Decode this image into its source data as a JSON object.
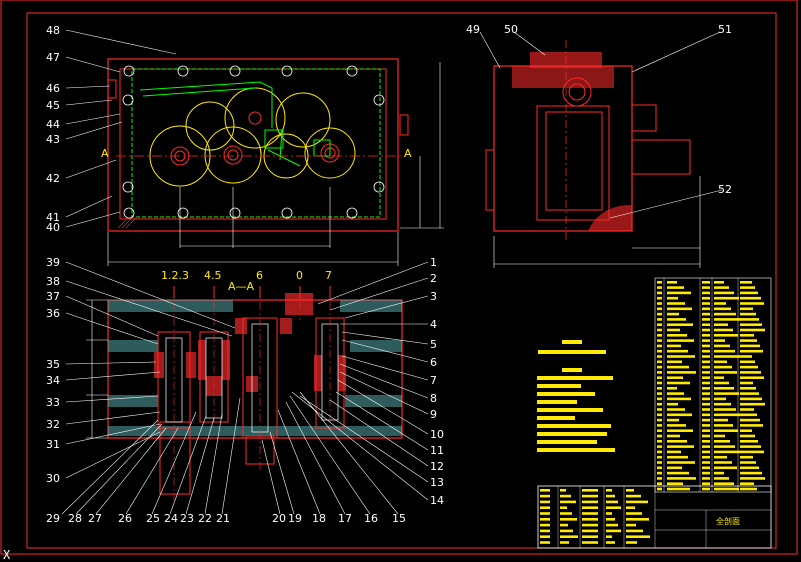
{
  "top_view_labels": [
    "48",
    "47",
    "46",
    "45",
    "44",
    "43",
    "42",
    "41",
    "40"
  ],
  "side_view_labels": [
    "49",
    "50",
    "51",
    "52"
  ],
  "section_left_labels": [
    "39",
    "38",
    "37",
    "36",
    "35",
    "34",
    "33",
    "32",
    "31",
    "30"
  ],
  "section_right_labels": [
    "1",
    "2",
    "3",
    "4",
    "5",
    "6",
    "7",
    "8",
    "9",
    "10",
    "11",
    "12",
    "13",
    "14"
  ],
  "section_bottom_labels": [
    "29",
    "28",
    "27",
    "26",
    "25",
    "24",
    "23",
    "22",
    "21",
    "20",
    "19",
    "18",
    "17",
    "16",
    "15"
  ],
  "shaft_labels": [
    "1.2.3",
    "4.5",
    "6",
    "0",
    "7"
  ],
  "section_marker": "A",
  "section_title": "A—A",
  "title_block_name": "全剖面"
}
